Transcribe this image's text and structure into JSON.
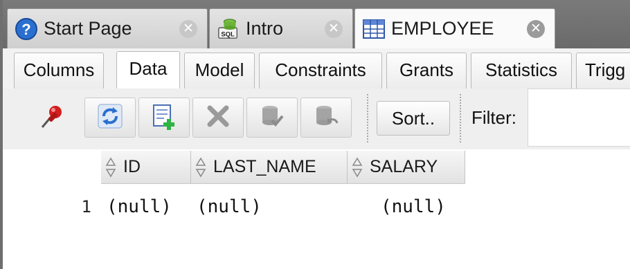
{
  "doc_tabs": [
    {
      "label": "Start Page",
      "icon": "help-icon"
    },
    {
      "label": "Intro",
      "icon": "sql-worksheet-icon"
    },
    {
      "label": "EMPLOYEE",
      "icon": "table-icon",
      "active": true
    }
  ],
  "sub_tabs": [
    "Columns",
    "Data",
    "Model",
    "Constraints",
    "Grants",
    "Statistics",
    "Trigg"
  ],
  "active_sub_tab": "Data",
  "toolbar": {
    "icons": [
      "freeze-pin-icon",
      "refresh-icon",
      "insert-row-icon",
      "delete-row-icon",
      "commit-icon",
      "rollback-icon"
    ],
    "sort_label": "Sort..",
    "filter_label": "Filter:",
    "filter_value": ""
  },
  "grid": {
    "columns": [
      "ID",
      "LAST_NAME",
      "SALARY"
    ],
    "rows": [
      {
        "row_number": "1",
        "cells": [
          "(null)",
          "(null)",
          "(null)"
        ]
      }
    ]
  },
  "colors": {
    "chrome_dark": "#6a6a6a",
    "accent_blue": "#2a6fd0",
    "pin_red": "#d21f1f",
    "add_green": "#2fb344"
  }
}
